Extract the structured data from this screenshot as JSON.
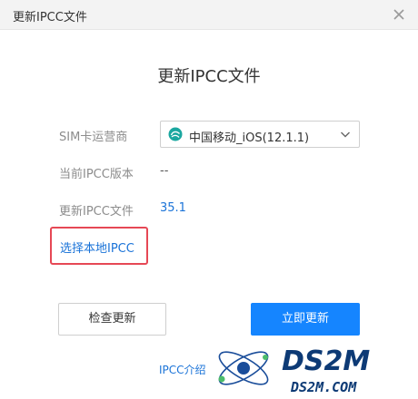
{
  "window": {
    "title": "更新IPCC文件"
  },
  "heading": "更新IPCC文件",
  "form": {
    "carrier_label": "SIM卡运营商",
    "carrier_value": "中国移动_iOS(12.1.1)",
    "current_version_label": "当前IPCC版本",
    "current_version_value": "--",
    "update_file_label": "更新IPCC文件",
    "update_file_value": "35.1"
  },
  "choose_local": "选择本地IPCC",
  "buttons": {
    "check": "检查更新",
    "update": "立即更新"
  },
  "intro_link": "IPCC介绍",
  "watermark": {
    "brand": "DS2M",
    "site": "DS2M.COM"
  },
  "colors": {
    "primary": "#1585ff",
    "link": "#1a73d8",
    "highlight": "#e64855",
    "carrier_logo": "#1aa7a0"
  },
  "icons": {
    "close": "close-icon",
    "chevron": "chevron-down-icon",
    "carrier": "china-mobile-logo-icon"
  }
}
